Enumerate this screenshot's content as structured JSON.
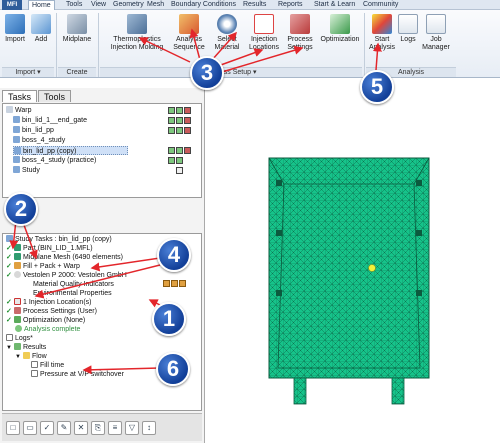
{
  "app": {
    "logo_text": "MFI"
  },
  "ribbon_tabs": [
    "Home",
    "Tools",
    "View",
    "Geometry",
    "Mesh",
    "Boundary Conditions",
    "Results",
    "Reports",
    "Start & Learn",
    "Community"
  ],
  "ribbon": {
    "import_label": "Import",
    "add_label": "Add",
    "midplane_label": "Midplane",
    "thermoplastics_label_1": "Thermoplastics",
    "thermoplastics_label_2": "Injection Molding",
    "analysis_seq_label_1": "Analysis",
    "analysis_seq_label_2": "Sequence",
    "select_material_label_1": "Select",
    "select_material_label_2": "Material",
    "injection_locations_label_1": "Injection",
    "injection_locations_label_2": "Locations",
    "process_settings_label_1": "Process",
    "process_settings_label_2": "Settings",
    "optimization_label": "Optimization",
    "start_analysis_label_1": "Start",
    "start_analysis_label_2": "Analysis",
    "logs_label": "Logs",
    "job_manager_label_1": "Job",
    "job_manager_label_2": "Manager",
    "group_import": "Import ▾",
    "group_create": "Create",
    "group_process_setup": "Process Setup ▾",
    "group_analysis": "Analysis"
  },
  "panel": {
    "tabs": [
      "Tasks",
      "Tools"
    ],
    "project": {
      "root": "Warp",
      "items": [
        "bin_lid_1__end_gate",
        "bin_lid_pp",
        "boss_4_study",
        "bin_lid_pp (copy)",
        "boss_4_study (practice)",
        "Study"
      ]
    },
    "study": {
      "title": "Study Tasks : bin_lid_pp (copy)",
      "items": [
        "Part (BIN_LID_1.MFL)",
        "Midplane Mesh (6490 elements)",
        "Fill + Pack + Warp",
        "Vestolen P 2000: Vestolen GmbH",
        "Material Quality Indicators",
        "Environmental Properties",
        "1 Injection Location(s)",
        "Process Settings (User)",
        "Optimization (None)",
        "Analysis complete",
        "Logs*",
        "Results",
        "Flow",
        "Fill time",
        "Pressure at V/P switchover"
      ]
    }
  },
  "callouts": [
    "1",
    "2",
    "3",
    "4",
    "5",
    "6"
  ],
  "colors": {
    "mesh": "#16c38a",
    "mesh_edge": "#0d6b4b",
    "callout": "#1b4faa",
    "arrow": "#e3262b"
  }
}
